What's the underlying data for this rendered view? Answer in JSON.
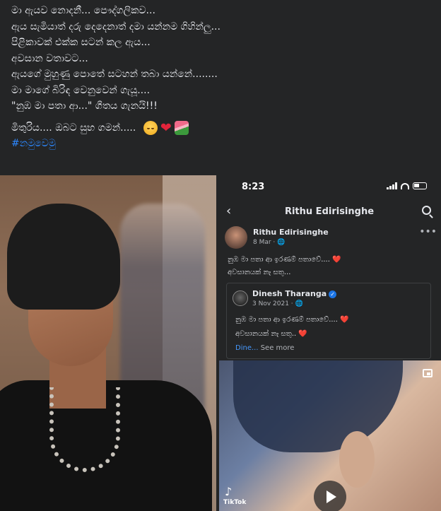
{
  "post": {
    "lines": [
      "මා ඇයව නොදනී... පෞද්ගලිකව...",
      "ඇය සැමියාත් දරු දෙදෙනාත් දමා යන්නම ගිහින්ලු...",
      "පිළිකාවක් එක්ක සටන් කල ඇය...",
      "අවසාන වතාවට...",
      "ඇයගේ මුහුණු පොතේ සටහන් තබා යන්නේ........",
      "මා මාගේ බිරිඳ වෙනුවෙන් ගැයූ....",
      "\"නුඹ මා පතා ආ...\" ගීතය ගැනයි!!!"
    ],
    "closing": "මිතුරිය.... ඔබට සුභ ගමන්.....",
    "emojis": [
      "pensive-face",
      "red-heart",
      "bouquet"
    ],
    "hashtag": "#නමුවෙමු"
  },
  "phone": {
    "time": "8:23",
    "page_title": "Rithu Edirisinghe",
    "author": "Rithu Edirisinghe",
    "date": "8 Mar · ",
    "text_line1": "නුඹ මා පතා ආ ඉරණම් පතාවේ.... ❤️",
    "text_line2": "අවසානයක් නෑ සතු...",
    "shared": {
      "author": "Dinesh Tharanga",
      "date": "3 Nov 2021 · ",
      "text_line1": "නුඹ මා පතා ආ ඉරණම් පතාවේ.... ❤️",
      "text_line2": "අවසානයක් නෑ සතු.. ❤️",
      "dine": "Dine...",
      "see_more": "See more"
    },
    "video": {
      "watermark": "TikTok"
    }
  },
  "colors": {
    "background": "#242526",
    "text": "#e4e6eb",
    "hashtag": "#2d88ff",
    "link": "#4599ff"
  }
}
